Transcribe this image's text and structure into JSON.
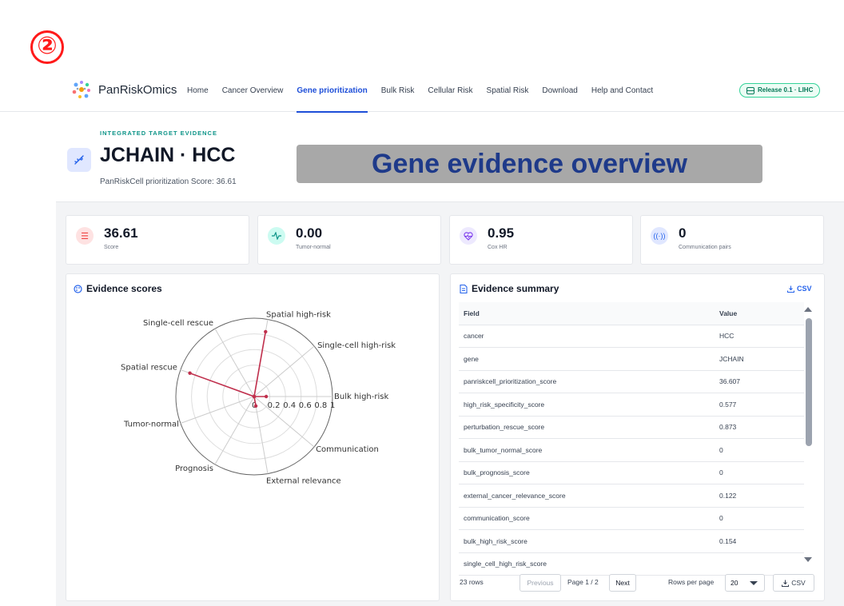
{
  "step_marker": "②",
  "nav": {
    "brand": "PanRiskOmics",
    "links": [
      "Home",
      "Cancer Overview",
      "Gene prioritization",
      "Bulk Risk",
      "Cellular Risk",
      "Spatial Risk",
      "Download",
      "Help and Contact"
    ],
    "active_index": 2,
    "release_badge": "Release 0.1 · LIHC"
  },
  "header": {
    "eyebrow": "INTEGRATED TARGET EVIDENCE",
    "title": "JCHAIN · HCC",
    "subtitle": "PanRiskCell prioritization Score: 36.61",
    "banner": "Gene evidence overview"
  },
  "metrics": [
    {
      "value": "36.61",
      "label": "Score",
      "icon": "list-icon",
      "color": "#ef4444",
      "bg": "#fee2e2"
    },
    {
      "value": "0.00",
      "label": "Tumor-normal",
      "icon": "pulse-icon",
      "color": "#0d9488",
      "bg": "#ccfbf1"
    },
    {
      "value": "0.95",
      "label": "Cox HR",
      "icon": "heart-pulse-icon",
      "color": "#7c3aed",
      "bg": "#ede9fe"
    },
    {
      "value": "0",
      "label": "Communication pairs",
      "icon": "signal-icon",
      "color": "#2563eb",
      "bg": "#e0e7ff"
    }
  ],
  "evidence_scores": {
    "title": "Evidence scores",
    "chart_data": {
      "type": "radar",
      "axes": [
        "Spatial high-risk",
        "Single-cell high-risk",
        "Bulk high-risk",
        "Communication",
        "External relevance",
        "Prognosis",
        "Tumor-normal",
        "Spatial rescue",
        "Single-cell rescue"
      ],
      "values": [
        0.84,
        0,
        0.154,
        0,
        0.122,
        0,
        0,
        0.873,
        0
      ],
      "range": [
        0,
        1
      ],
      "ticks": [
        "0",
        "0.2",
        "0.4",
        "0.6",
        "0.8",
        "1"
      ],
      "series_color": "#c0304d"
    }
  },
  "evidence_summary": {
    "title": "Evidence summary",
    "csv_link": "CSV",
    "columns": [
      "Field",
      "Value"
    ],
    "rows": [
      [
        "cancer",
        "HCC"
      ],
      [
        "gene",
        "JCHAIN"
      ],
      [
        "panriskcell_prioritization_score",
        "36.607"
      ],
      [
        "high_risk_specificity_score",
        "0.577"
      ],
      [
        "perturbation_rescue_score",
        "0.873"
      ],
      [
        "bulk_tumor_normal_score",
        "0"
      ],
      [
        "bulk_prognosis_score",
        "0"
      ],
      [
        "external_cancer_relevance_score",
        "0.122"
      ],
      [
        "communication_score",
        "0"
      ],
      [
        "bulk_high_risk_score",
        "0.154"
      ],
      [
        "single_cell_high_risk_score",
        ""
      ]
    ],
    "row_count": "23 rows",
    "prev_label": "Previous",
    "page_label": "Page 1 / 2",
    "next_label": "Next",
    "rows_per_page_label": "Rows per page",
    "rows_per_page_value": "20",
    "csv_button": "CSV"
  }
}
